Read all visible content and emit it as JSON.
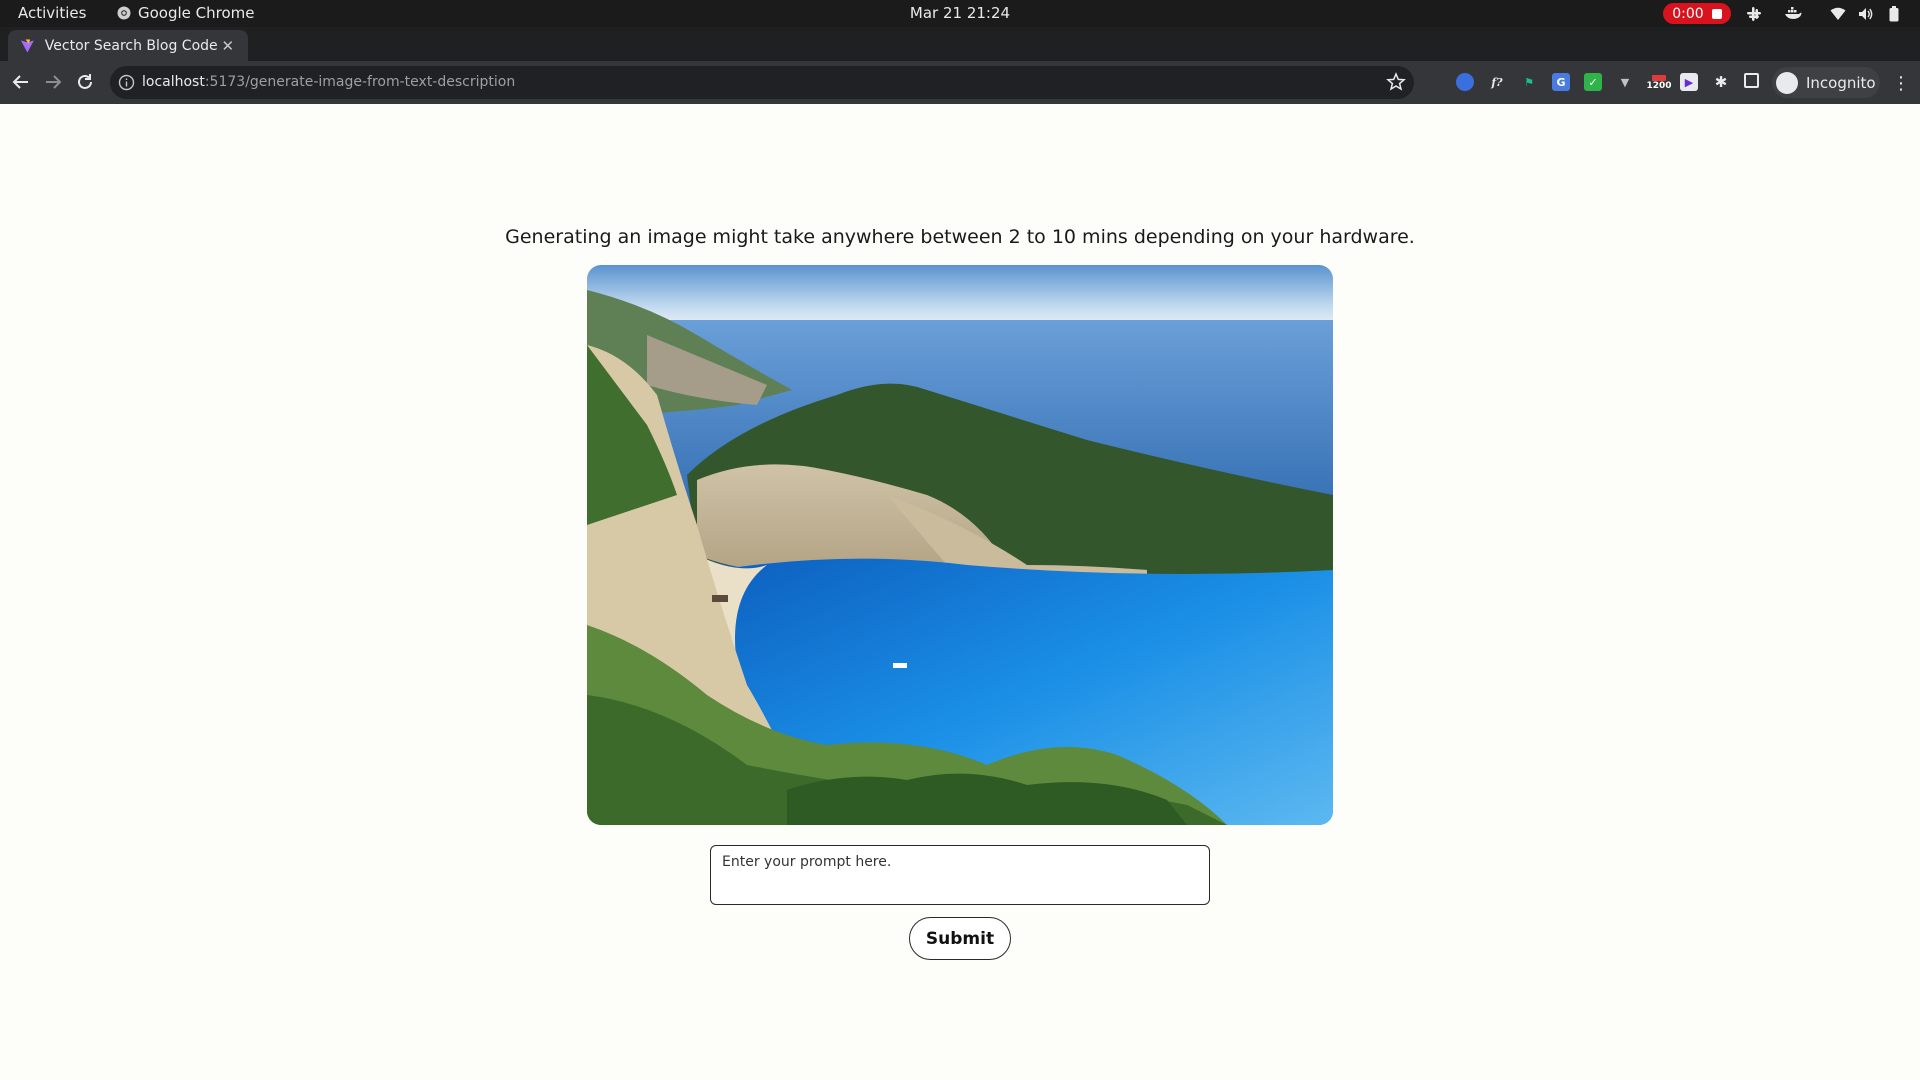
{
  "system_bar": {
    "activities": "Activities",
    "app_name": "Google Chrome",
    "clock": "Mar 21  21:24",
    "recording_time": "0:00"
  },
  "browser": {
    "tab_title": "Vector Search Blog Code",
    "url_host": "localhost",
    "url_path": ":5173/generate-image-from-text-description",
    "extension_badge": "1200",
    "profile_label": "Incognito"
  },
  "page": {
    "info_text": "Generating an image might take anywhere between 2 to 10 mins depending on your hardware.",
    "prompt_placeholder": "Enter your prompt here.",
    "prompt_value": "",
    "submit_label": "Submit"
  },
  "colors": {
    "page_bg": "#fdfdfa",
    "record_red": "#d9131d",
    "chrome_dark": "#35363a"
  }
}
